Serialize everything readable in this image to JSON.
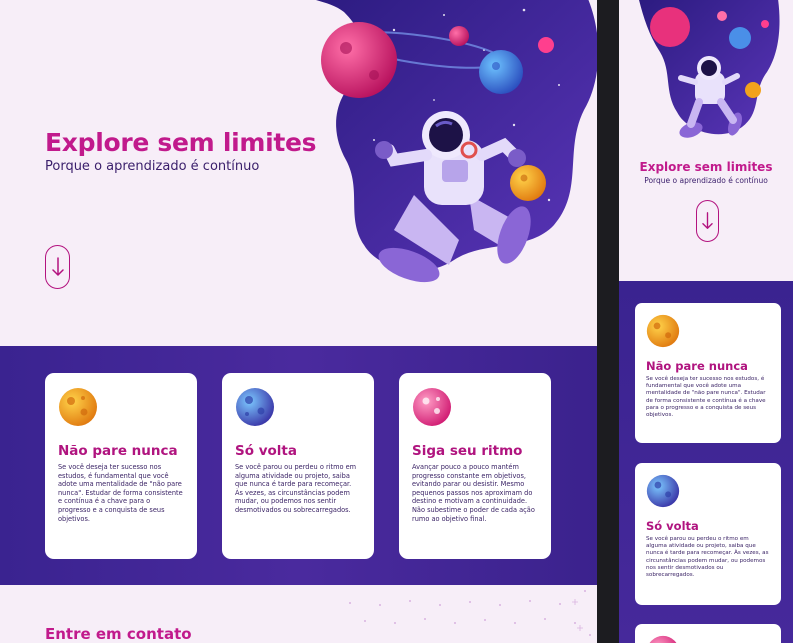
{
  "hero": {
    "title": "Explore sem limites",
    "subtitle": "Porque o aprendizado é contínuo",
    "scroll_icon": "arrow-down-icon"
  },
  "cards": [
    {
      "title": "Não pare nunca",
      "icon": "orange-planet-icon",
      "text": "Se você deseja ter sucesso nos estudos, é fundamental que você adote uma mentalidade de \"não pare nunca\". Estudar de forma consistente e contínua é a chave para o progresso e a conquista de seus objetivos."
    },
    {
      "title": "Só volta",
      "icon": "blue-planet-icon",
      "text": "Se você parou ou perdeu o ritmo em alguma atividade ou projeto, saiba que nunca é tarde para recomeçar. Às vezes, as circunstâncias podem mudar, ou podemos nos sentir desmotivados ou sobrecarregados."
    },
    {
      "title": "Siga seu ritmo",
      "icon": "pink-planet-icon",
      "text": "Avançar pouco a pouco mantém progresso constante em objetivos, evitando parar ou desistir. Mesmo pequenos passos nos aproximam do destino e motivam a continuidade. Não subestime o poder de cada ação rumo ao objetivo final."
    }
  ],
  "contact": {
    "title": "Entre em contato"
  },
  "colors": {
    "brand": "#c11a8c",
    "band": "#3a2390",
    "card_bg": "#ffffff",
    "text_dark": "#3b2466"
  }
}
